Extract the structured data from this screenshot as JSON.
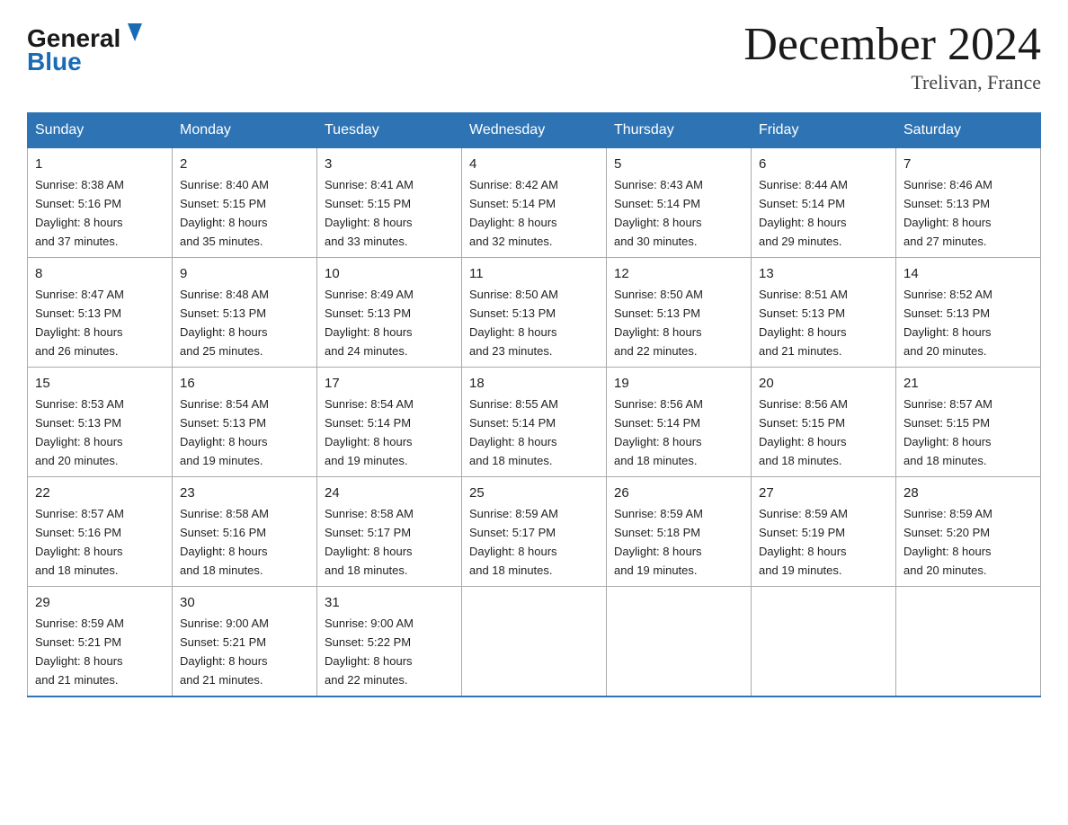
{
  "header": {
    "logo_text_general": "General",
    "logo_text_blue": "Blue",
    "month_year": "December 2024",
    "location": "Trelivan, France"
  },
  "days_of_week": [
    "Sunday",
    "Monday",
    "Tuesday",
    "Wednesday",
    "Thursday",
    "Friday",
    "Saturday"
  ],
  "weeks": [
    [
      {
        "day": "1",
        "sunrise": "8:38 AM",
        "sunset": "5:16 PM",
        "daylight": "8 hours and 37 minutes."
      },
      {
        "day": "2",
        "sunrise": "8:40 AM",
        "sunset": "5:15 PM",
        "daylight": "8 hours and 35 minutes."
      },
      {
        "day": "3",
        "sunrise": "8:41 AM",
        "sunset": "5:15 PM",
        "daylight": "8 hours and 33 minutes."
      },
      {
        "day": "4",
        "sunrise": "8:42 AM",
        "sunset": "5:14 PM",
        "daylight": "8 hours and 32 minutes."
      },
      {
        "day": "5",
        "sunrise": "8:43 AM",
        "sunset": "5:14 PM",
        "daylight": "8 hours and 30 minutes."
      },
      {
        "day": "6",
        "sunrise": "8:44 AM",
        "sunset": "5:14 PM",
        "daylight": "8 hours and 29 minutes."
      },
      {
        "day": "7",
        "sunrise": "8:46 AM",
        "sunset": "5:13 PM",
        "daylight": "8 hours and 27 minutes."
      }
    ],
    [
      {
        "day": "8",
        "sunrise": "8:47 AM",
        "sunset": "5:13 PM",
        "daylight": "8 hours and 26 minutes."
      },
      {
        "day": "9",
        "sunrise": "8:48 AM",
        "sunset": "5:13 PM",
        "daylight": "8 hours and 25 minutes."
      },
      {
        "day": "10",
        "sunrise": "8:49 AM",
        "sunset": "5:13 PM",
        "daylight": "8 hours and 24 minutes."
      },
      {
        "day": "11",
        "sunrise": "8:50 AM",
        "sunset": "5:13 PM",
        "daylight": "8 hours and 23 minutes."
      },
      {
        "day": "12",
        "sunrise": "8:50 AM",
        "sunset": "5:13 PM",
        "daylight": "8 hours and 22 minutes."
      },
      {
        "day": "13",
        "sunrise": "8:51 AM",
        "sunset": "5:13 PM",
        "daylight": "8 hours and 21 minutes."
      },
      {
        "day": "14",
        "sunrise": "8:52 AM",
        "sunset": "5:13 PM",
        "daylight": "8 hours and 20 minutes."
      }
    ],
    [
      {
        "day": "15",
        "sunrise": "8:53 AM",
        "sunset": "5:13 PM",
        "daylight": "8 hours and 20 minutes."
      },
      {
        "day": "16",
        "sunrise": "8:54 AM",
        "sunset": "5:13 PM",
        "daylight": "8 hours and 19 minutes."
      },
      {
        "day": "17",
        "sunrise": "8:54 AM",
        "sunset": "5:14 PM",
        "daylight": "8 hours and 19 minutes."
      },
      {
        "day": "18",
        "sunrise": "8:55 AM",
        "sunset": "5:14 PM",
        "daylight": "8 hours and 18 minutes."
      },
      {
        "day": "19",
        "sunrise": "8:56 AM",
        "sunset": "5:14 PM",
        "daylight": "8 hours and 18 minutes."
      },
      {
        "day": "20",
        "sunrise": "8:56 AM",
        "sunset": "5:15 PM",
        "daylight": "8 hours and 18 minutes."
      },
      {
        "day": "21",
        "sunrise": "8:57 AM",
        "sunset": "5:15 PM",
        "daylight": "8 hours and 18 minutes."
      }
    ],
    [
      {
        "day": "22",
        "sunrise": "8:57 AM",
        "sunset": "5:16 PM",
        "daylight": "8 hours and 18 minutes."
      },
      {
        "day": "23",
        "sunrise": "8:58 AM",
        "sunset": "5:16 PM",
        "daylight": "8 hours and 18 minutes."
      },
      {
        "day": "24",
        "sunrise": "8:58 AM",
        "sunset": "5:17 PM",
        "daylight": "8 hours and 18 minutes."
      },
      {
        "day": "25",
        "sunrise": "8:59 AM",
        "sunset": "5:17 PM",
        "daylight": "8 hours and 18 minutes."
      },
      {
        "day": "26",
        "sunrise": "8:59 AM",
        "sunset": "5:18 PM",
        "daylight": "8 hours and 19 minutes."
      },
      {
        "day": "27",
        "sunrise": "8:59 AM",
        "sunset": "5:19 PM",
        "daylight": "8 hours and 19 minutes."
      },
      {
        "day": "28",
        "sunrise": "8:59 AM",
        "sunset": "5:20 PM",
        "daylight": "8 hours and 20 minutes."
      }
    ],
    [
      {
        "day": "29",
        "sunrise": "8:59 AM",
        "sunset": "5:21 PM",
        "daylight": "8 hours and 21 minutes."
      },
      {
        "day": "30",
        "sunrise": "9:00 AM",
        "sunset": "5:21 PM",
        "daylight": "8 hours and 21 minutes."
      },
      {
        "day": "31",
        "sunrise": "9:00 AM",
        "sunset": "5:22 PM",
        "daylight": "8 hours and 22 minutes."
      },
      null,
      null,
      null,
      null
    ]
  ],
  "labels": {
    "sunrise": "Sunrise:",
    "sunset": "Sunset:",
    "daylight": "Daylight:"
  }
}
